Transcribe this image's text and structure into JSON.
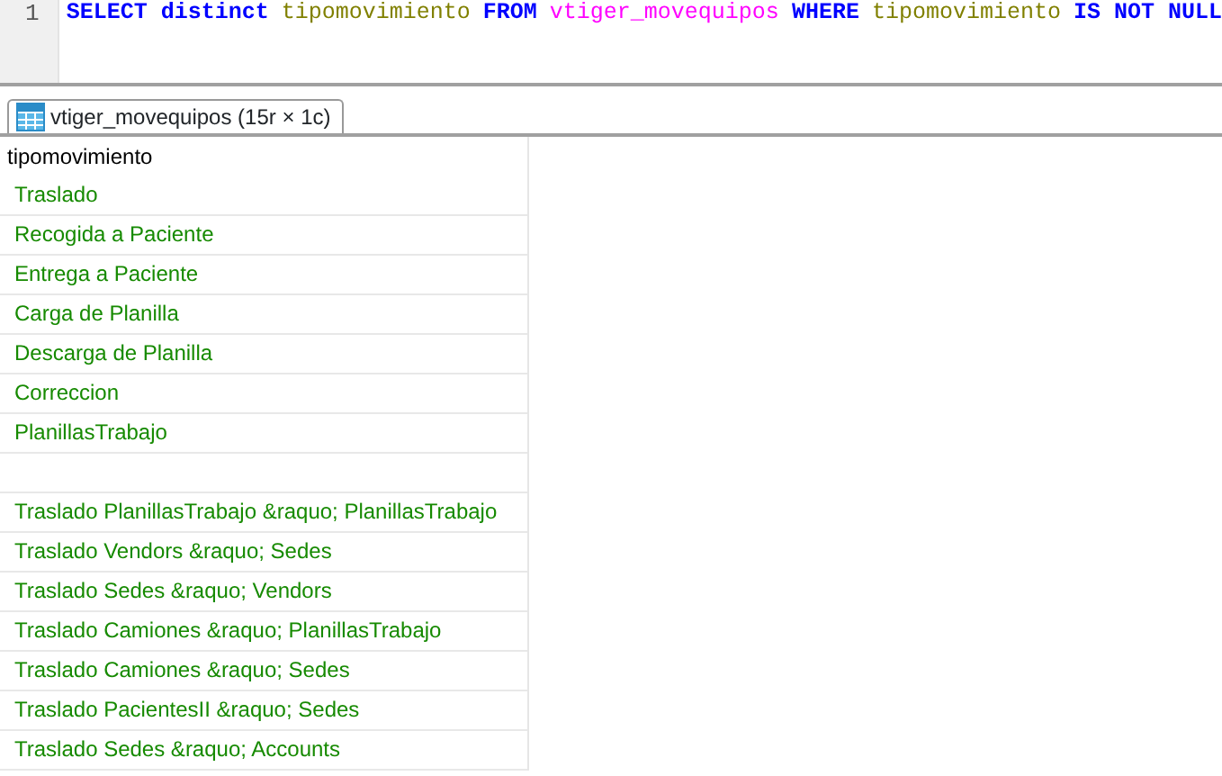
{
  "editor": {
    "line_numbers": [
      "1"
    ],
    "tokens": [
      {
        "text": "SELECT distinct",
        "kind": "keyword"
      },
      {
        "text": "tipomovimiento",
        "kind": "column"
      },
      {
        "text": "FROM",
        "kind": "keyword"
      },
      {
        "text": "vtiger_movequipos",
        "kind": "table"
      },
      {
        "text": "WHERE",
        "kind": "keyword"
      },
      {
        "text": "tipomovimiento",
        "kind": "column"
      },
      {
        "text": "IS NOT NULL",
        "kind": "keyword"
      }
    ]
  },
  "result_tabs": [
    {
      "label": "vtiger_movequipos (15r × 1c)",
      "selected": true
    }
  ],
  "table": {
    "columns": [
      "tipomovimiento"
    ],
    "rows": [
      "Traslado",
      "Recogida a Paciente",
      "Entrega a Paciente",
      "Carga de Planilla",
      "Descarga de Planilla",
      "Correccion",
      "PlanillasTrabajo",
      null,
      "Traslado PlanillasTrabajo &raquo; PlanillasTrabajo",
      "Traslado Vendors &raquo; Sedes",
      "Traslado Sedes &raquo; Vendors",
      "Traslado Camiones &raquo; PlanillasTrabajo",
      "Traslado Camiones &raquo; Sedes",
      "Traslado PacientesII &raquo; Sedes",
      "Traslado Sedes &raquo; Accounts"
    ]
  }
}
